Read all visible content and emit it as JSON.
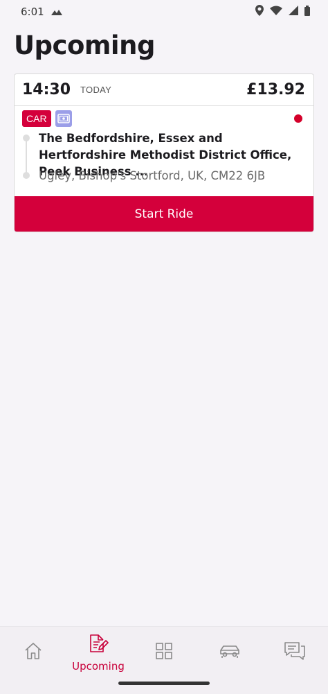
{
  "status_bar": {
    "time": "6:01"
  },
  "page": {
    "title": "Upcoming"
  },
  "ride": {
    "time": "14:30",
    "day": "TODAY",
    "price": "£13.92",
    "vehicle_badge": "CAR",
    "pickup": "The Bedfordshire, Essex and Hertfordshire Methodist District Office, Peek Business ...",
    "dropoff": "Ugley, Bishop's Stortford, UK, CM22 6JB",
    "start_button_label": "Start Ride"
  },
  "bottom_nav": {
    "items": [
      {
        "icon": "home-icon",
        "label": ""
      },
      {
        "icon": "document-edit-icon",
        "label": "Upcoming"
      },
      {
        "icon": "grid-icon",
        "label": ""
      },
      {
        "icon": "car-icon",
        "label": ""
      },
      {
        "icon": "chat-icon",
        "label": ""
      }
    ]
  },
  "colors": {
    "accent": "#d4003b",
    "payment_badge": "#9b9ee8",
    "background": "#f6f4f8"
  }
}
